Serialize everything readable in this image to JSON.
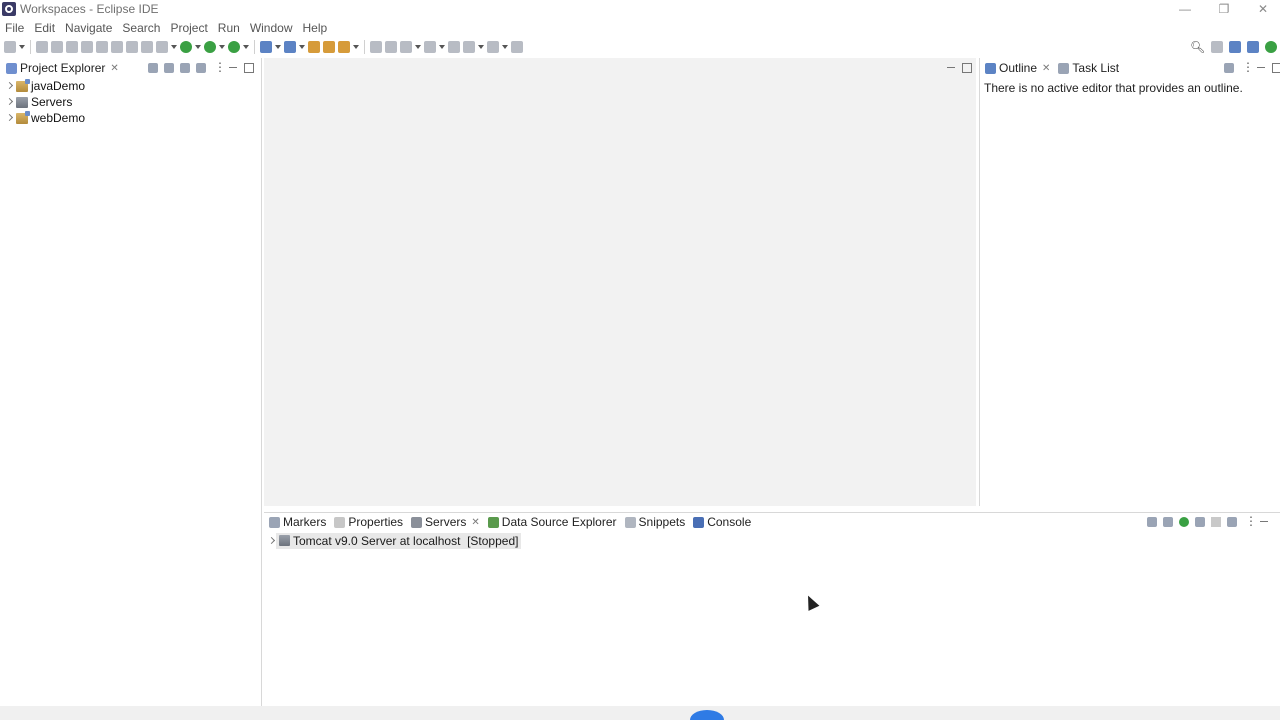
{
  "window": {
    "title": "Workspaces - Eclipse IDE",
    "controls": [
      "—",
      "❐",
      "✕"
    ]
  },
  "menu": [
    "File",
    "Edit",
    "Navigate",
    "Search",
    "Project",
    "Run",
    "Window",
    "Help"
  ],
  "project_explorer": {
    "tab_label": "Project Explorer",
    "items": [
      {
        "label": "javaDemo",
        "icon": "java-project-icon"
      },
      {
        "label": "Servers",
        "icon": "servers-folder-icon"
      },
      {
        "label": "webDemo",
        "icon": "web-project-icon"
      }
    ]
  },
  "outline": {
    "tabs": [
      "Outline",
      "Task List"
    ],
    "message": "There is no active editor that provides an outline."
  },
  "bottom_panel": {
    "tabs": [
      "Markers",
      "Properties",
      "Servers",
      "Data Source Explorer",
      "Snippets",
      "Console"
    ],
    "active_tab": "Servers",
    "server_entry": "Tomcat v9.0 Server at localhost  [Stopped]"
  },
  "colors": {
    "background": "#ffffff",
    "editor_area": "#f2f2f2",
    "accent": "#2f7be5"
  }
}
